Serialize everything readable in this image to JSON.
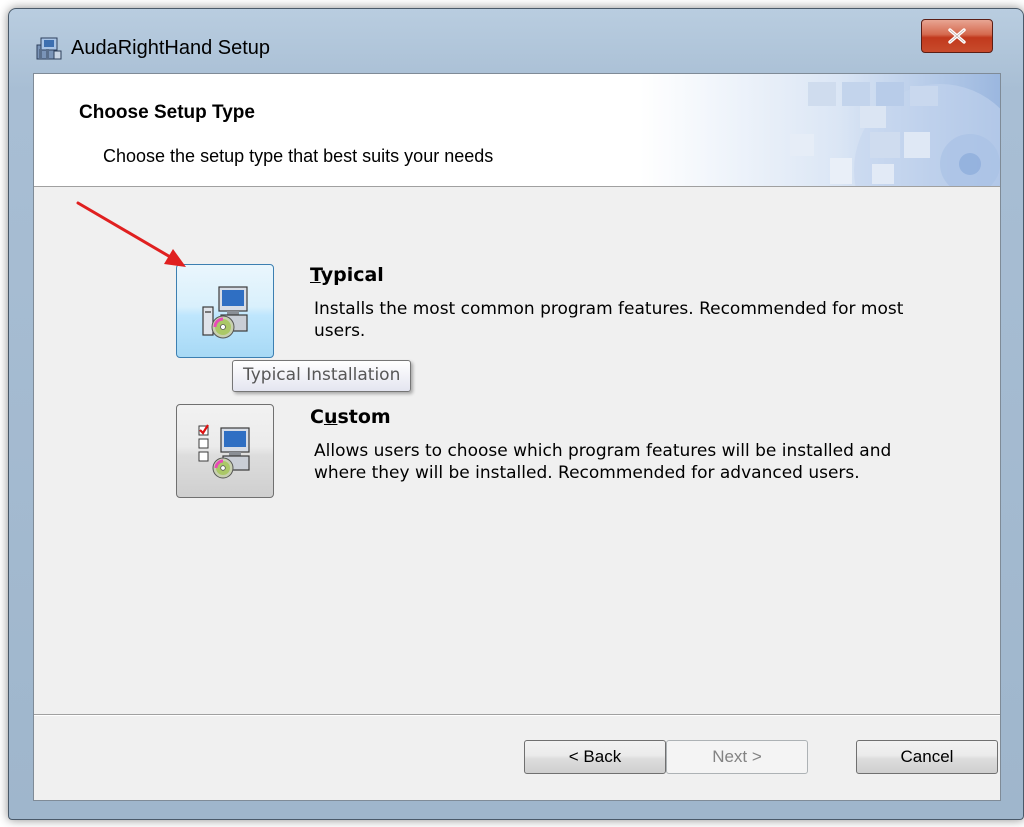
{
  "window": {
    "title": "AudaRightHand Setup",
    "close_icon": "close-icon",
    "app_icon": "setup-package-icon"
  },
  "banner": {
    "title": "Choose Setup Type",
    "subtitle": "Choose the setup type that best suits your needs"
  },
  "options": {
    "typical": {
      "title": "Typical",
      "mnemonic": "T",
      "title_rest": "ypical",
      "description": "Installs the most common program features. Recommended for most users.",
      "icon": "typical-install-icon",
      "tooltip": "Typical Installation"
    },
    "custom": {
      "title": "Custom",
      "title_first": "C",
      "mnemonic": "u",
      "title_rest": "stom",
      "description": "Allows users to choose which program features will be installed and where they will be installed. Recommended for advanced users.",
      "icon": "custom-install-icon"
    }
  },
  "buttons": {
    "back": "< Back",
    "next": "Next >",
    "cancel": "Cancel"
  },
  "annotation": {
    "arrow_color": "#e02020"
  }
}
